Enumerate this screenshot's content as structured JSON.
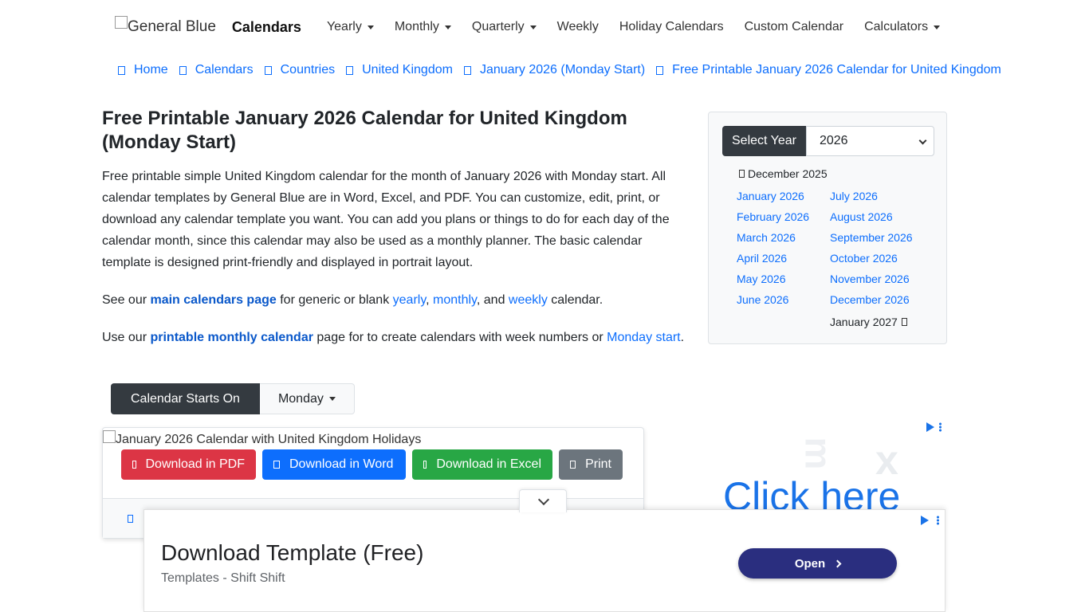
{
  "navbar": {
    "logo_alt": "General Blue",
    "brand": "Calendars",
    "items": [
      {
        "label": "Yearly",
        "dropdown": true
      },
      {
        "label": "Monthly",
        "dropdown": true
      },
      {
        "label": "Quarterly",
        "dropdown": true
      },
      {
        "label": "Weekly",
        "dropdown": false
      },
      {
        "label": "Holiday Calendars",
        "dropdown": false
      },
      {
        "label": "Custom Calendar",
        "dropdown": false
      },
      {
        "label": "Calculators",
        "dropdown": true
      }
    ]
  },
  "breadcrumb": [
    "Home",
    "Calendars",
    "Countries",
    "United Kingdom",
    "January 2026 (Monday Start)",
    "Free Printable January 2026 Calendar for United Kingdom"
  ],
  "main": {
    "title": "Free Printable January 2026 Calendar for United Kingdom (Monday Start)",
    "intro": "Free printable simple United Kingdom calendar for the month of January 2026 with Monday start. All calendar templates by General Blue are in Word, Excel, and PDF. You can customize, edit, print, or download any calendar template you want. You can add you plans or things to do for each day of the calendar month, since this calendar may also be used as a monthly planner. The basic calendar template is designed print-friendly and displayed in portrait layout.",
    "para2": {
      "prefix": "See our ",
      "link_main": "main calendars page",
      "mid1": " for generic or blank ",
      "link_yearly": "yearly",
      "sep1": ", ",
      "link_monthly": "monthly",
      "sep2": ", and ",
      "link_weekly": "weekly",
      "suffix": " calendar."
    },
    "para3": {
      "prefix": "Use our ",
      "link_printable": "printable monthly calendar",
      "mid": " page for to create calendars with week numbers or ",
      "link_monday": "Monday start",
      "suffix": "."
    }
  },
  "sidebar": {
    "select_year_label": "Select Year",
    "selected_year": "2026",
    "prev_month": "December 2025",
    "next_month": "January 2027",
    "months_col1": [
      "January 2026",
      "February 2026",
      "March 2026",
      "April 2026",
      "May 2026",
      "June 2026"
    ],
    "months_col2": [
      "July 2026",
      "August 2026",
      "September 2026",
      "October 2026",
      "November 2026",
      "December 2026"
    ]
  },
  "calendar": {
    "starts_on_label": "Calendar Starts On",
    "starts_on_value": "Monday",
    "image_alt": "January 2026 Calendar with United Kingdom Holidays",
    "buttons": {
      "pdf": "Download in PDF",
      "word": "Download in Word",
      "excel": "Download in Excel",
      "print": "Print"
    }
  },
  "side_ad": {
    "headline": "Click here"
  },
  "bottom_ad": {
    "title": "Download Template (Free)",
    "subtitle": "Templates - Shift Shift",
    "cta": "Open"
  },
  "colors": {
    "link": "#0d6efd",
    "dark": "#343a40",
    "pdf": "#dc3545",
    "word": "#0d6efd",
    "excel": "#28a745",
    "print": "#6c757d",
    "ad_cta": "#2a2e7f"
  }
}
